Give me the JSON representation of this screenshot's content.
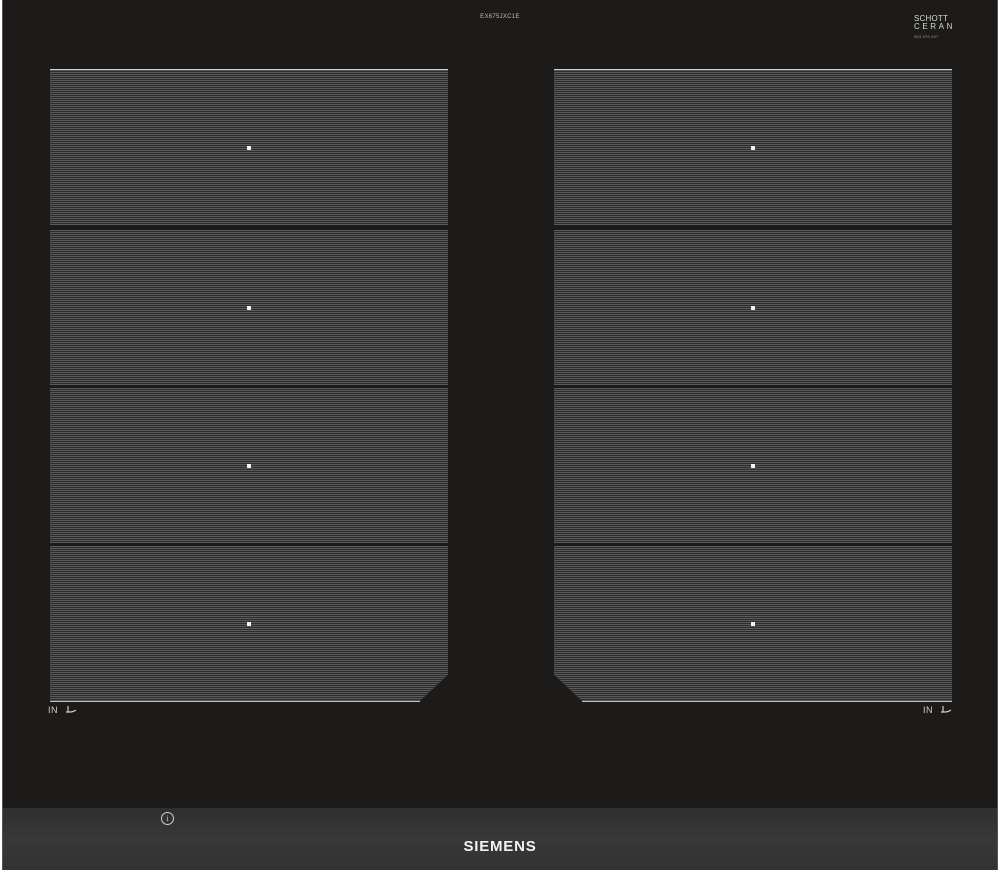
{
  "model_code": "EX675JXC1E",
  "ceramic_logo": {
    "line1": "SCHOTT",
    "line2": "CERAN",
    "line3": "963 079 007"
  },
  "zones_left": [
    {
      "id": "L1"
    },
    {
      "id": "L2"
    },
    {
      "id": "L3"
    },
    {
      "id": "L4"
    }
  ],
  "zones_right": [
    {
      "id": "R1"
    },
    {
      "id": "R2"
    },
    {
      "id": "R3"
    },
    {
      "id": "R4"
    }
  ],
  "flex_label_left": "IN",
  "flex_label_right": "IN",
  "info_symbol": "i",
  "brand": "SIEMENS",
  "colors": {
    "glass": "#1c1b1a",
    "zone": "#444444",
    "control_bar": "#353535",
    "marking": "#f4f4f4"
  }
}
